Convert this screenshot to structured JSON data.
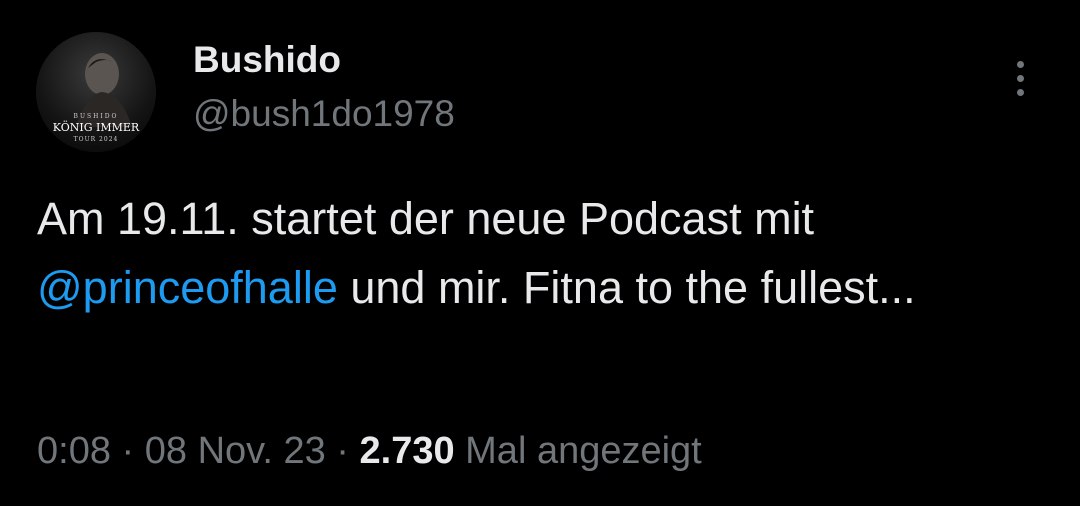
{
  "author": {
    "display_name": "Bushido",
    "handle": "@bush1do1978",
    "avatar": {
      "line1": "BUSHIDO",
      "line2": "KÖNIG IMMER",
      "line3": "TOUR 2024"
    }
  },
  "tweet": {
    "text_before": "Am 19.11. startet der neue Podcast mit",
    "mention": "@princeofhalle",
    "text_after": " und mir. Fitna to the fullest..."
  },
  "meta": {
    "time": "0:08",
    "separator": " · ",
    "date": "08 Nov. 23",
    "views_count": "2.730",
    "views_label": " Mal angezeigt"
  },
  "icons": {
    "more": "more-vertical-icon"
  },
  "colors": {
    "background": "#000000",
    "primary_text": "#e7e9ea",
    "secondary_text": "#71767b",
    "link": "#1d9bf0"
  }
}
